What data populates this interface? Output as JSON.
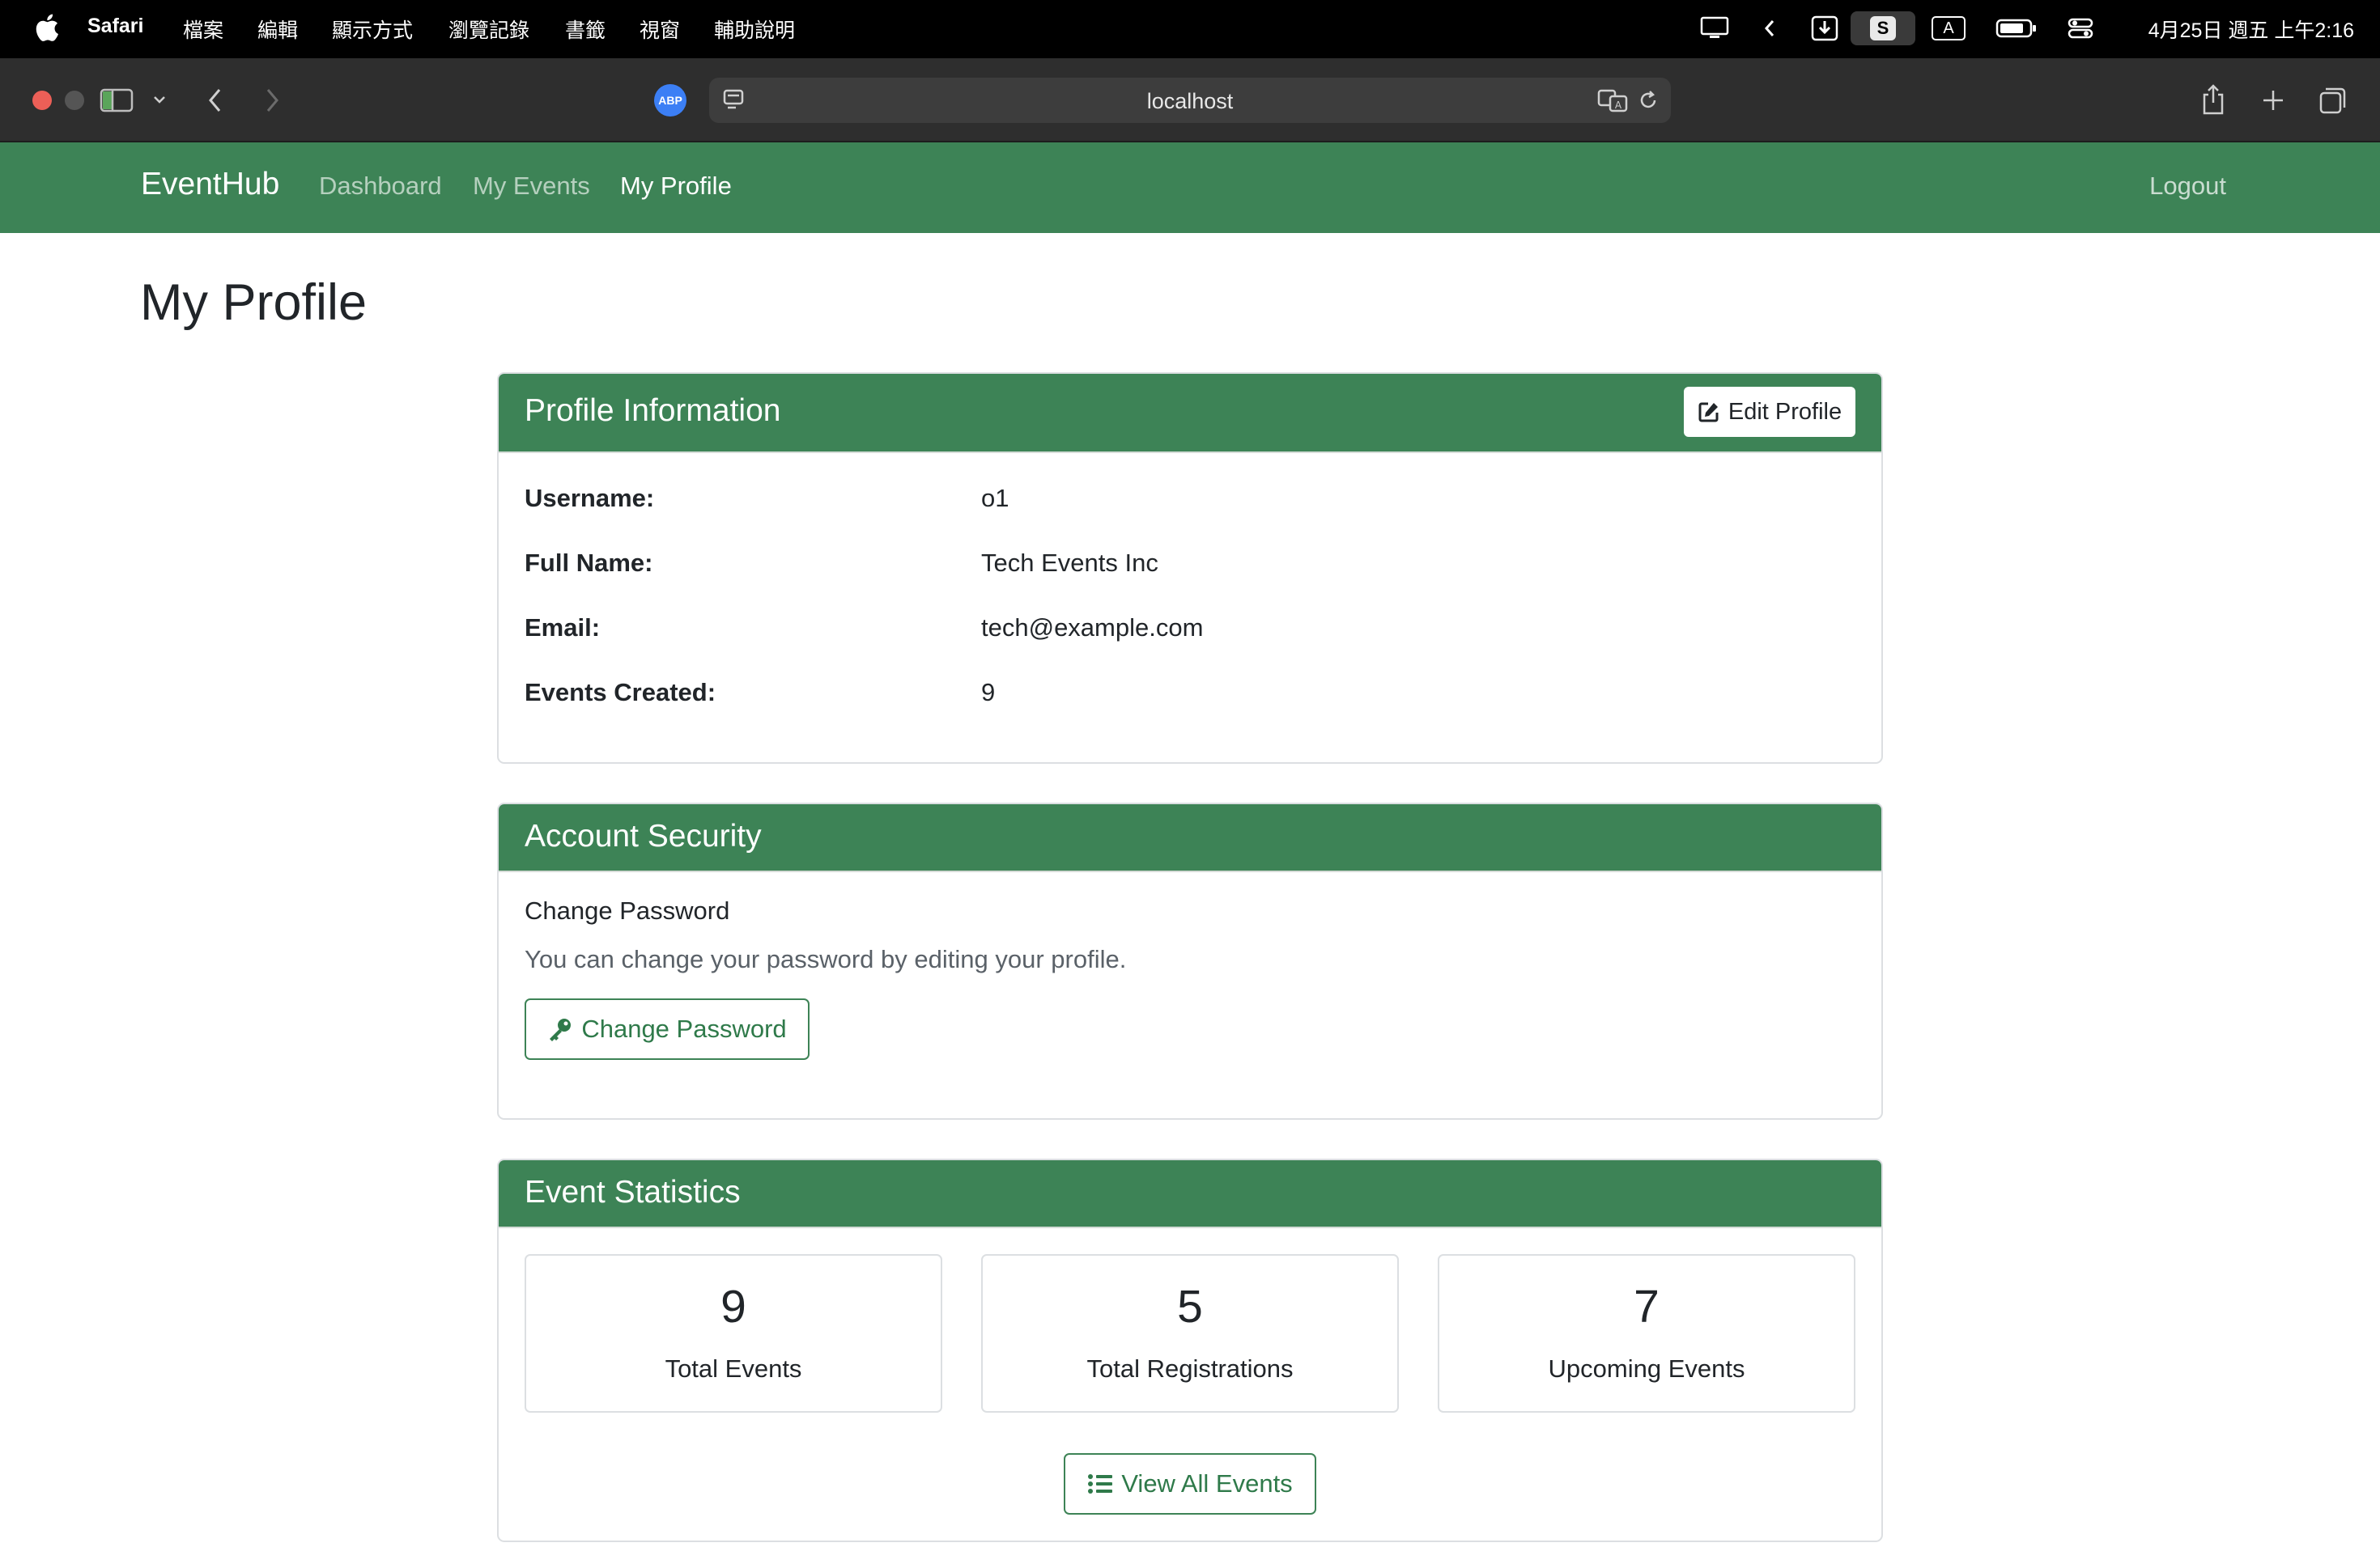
{
  "menubar": {
    "app_name": "Safari",
    "items": [
      "檔案",
      "編輯",
      "顯示方式",
      "瀏覽記錄",
      "書籤",
      "視窗",
      "輔助說明"
    ],
    "clock": "4月25日 週五 上午2:16",
    "status_s": "S",
    "status_a": "A"
  },
  "browser": {
    "url": "localhost",
    "abp_label": "ABP"
  },
  "navbar": {
    "brand": "EventHub",
    "links": [
      "Dashboard",
      "My Events",
      "My Profile"
    ],
    "active_link": "My Profile",
    "logout": "Logout",
    "color": "#3d8356"
  },
  "page": {
    "title": "My Profile"
  },
  "profile_card": {
    "title": "Profile Information",
    "edit_button": "Edit Profile",
    "rows": [
      {
        "label": "Username:",
        "value": "o1"
      },
      {
        "label": "Full Name:",
        "value": "Tech Events Inc"
      },
      {
        "label": "Email:",
        "value": "tech@example.com"
      },
      {
        "label": "Events Created:",
        "value": "9"
      }
    ]
  },
  "security_card": {
    "title": "Account Security",
    "subtitle": "Change Password",
    "description": "You can change your password by editing your profile.",
    "button": "Change Password"
  },
  "stats_card": {
    "title": "Event Statistics",
    "stats": [
      {
        "value": "9",
        "label": "Total Events"
      },
      {
        "value": "5",
        "label": "Total Registrations"
      },
      {
        "value": "7",
        "label": "Upcoming Events"
      }
    ],
    "button": "View All Events"
  }
}
